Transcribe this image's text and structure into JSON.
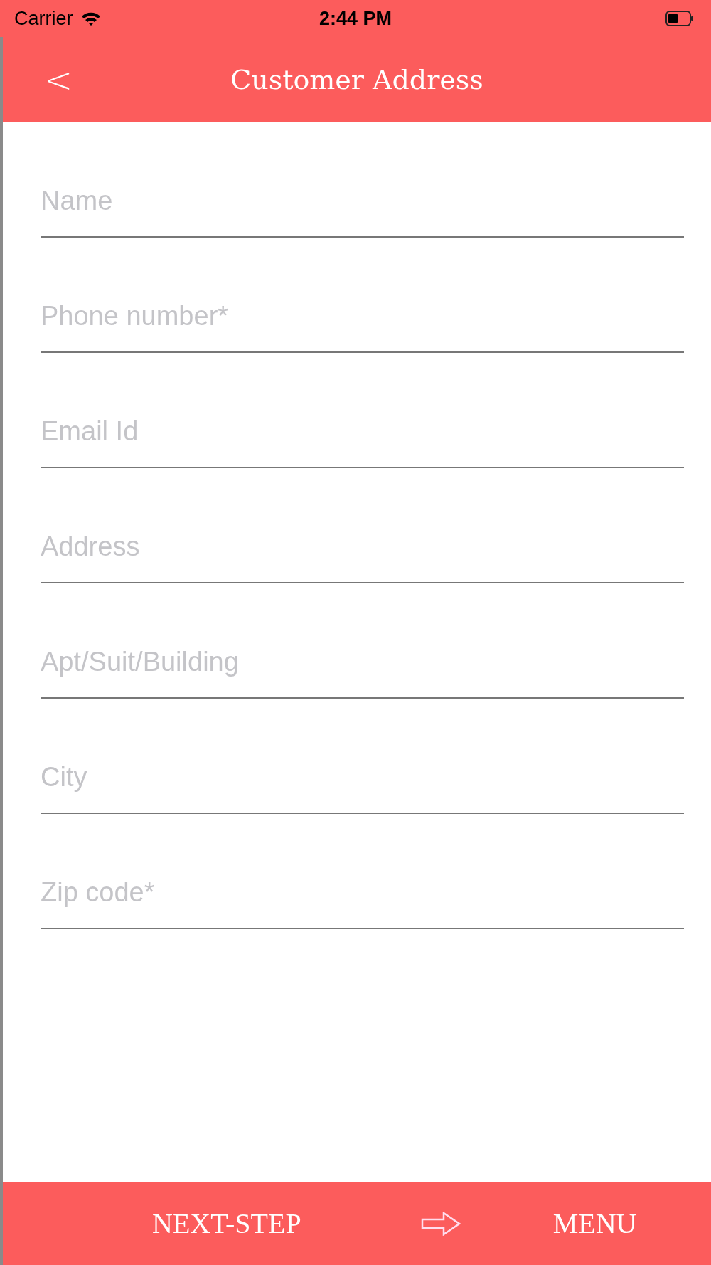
{
  "status_bar": {
    "carrier": "Carrier",
    "time": "2:44 PM"
  },
  "nav_bar": {
    "back": "<",
    "title": "Customer Address"
  },
  "fields": [
    {
      "placeholder": "Name"
    },
    {
      "placeholder": "Phone number*"
    },
    {
      "placeholder": "Email Id"
    },
    {
      "placeholder": "Address"
    },
    {
      "placeholder": "Apt/Suit/Building"
    },
    {
      "placeholder": "City"
    },
    {
      "placeholder": "Zip code*"
    }
  ],
  "bottom_bar": {
    "next": "NEXT-STEP",
    "menu": "MENU"
  }
}
